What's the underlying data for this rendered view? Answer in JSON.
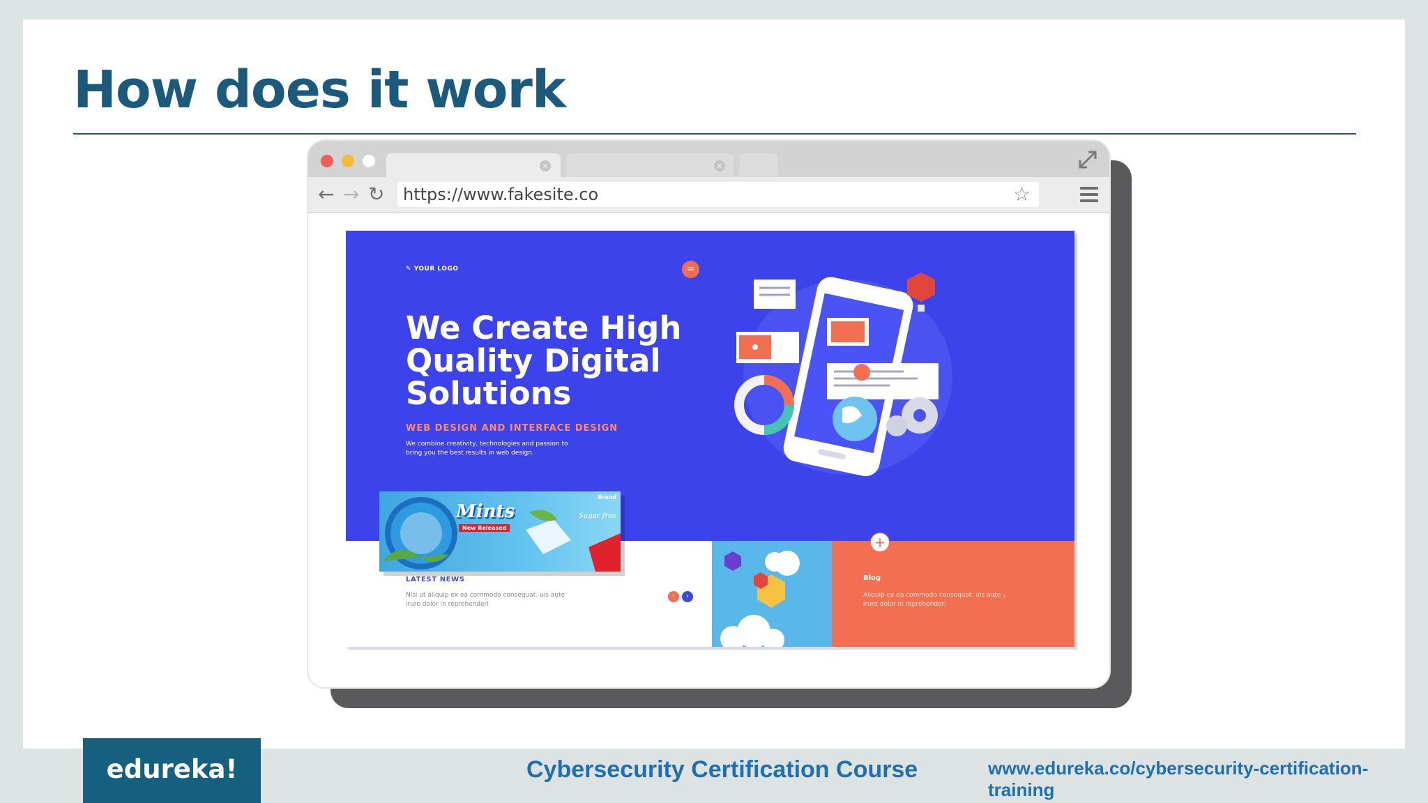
{
  "slide": {
    "title": "How does it work"
  },
  "browser": {
    "url": "https://www.fakesite.co",
    "colors": {
      "close": "#ee5f55",
      "minimize": "#f5bd34",
      "maximize": "#ffffff"
    }
  },
  "site": {
    "logo": "YOUR LOGO",
    "hero_title": "We Create High Quality Digital Solutions",
    "hero_subtitle": "WEB DESIGN AND INTERFACE DESIGN",
    "hero_description": "We combine creativity, technologies and passion to bring you the best results in web design.",
    "news_title": "LATEST NEWS",
    "news_text": "Nisi ut aliquip ex ea commodo consequat. uis aute irure dolor in reprehenderi",
    "blog_title": "Blog",
    "blog_text": "Aliquip ex ea commodo consequat. uis aute irure dolor in reprehenderi",
    "colors": {
      "hero": "#3d43ea",
      "accent": "#f36f52"
    }
  },
  "ad": {
    "brand": "Brand",
    "product": "Mints",
    "badge": "New Released",
    "tagline": "Sugar free"
  },
  "footer": {
    "logo": "edureka!",
    "course": "Cybersecurity Certification Course",
    "url": "www.edureka.co/cybersecurity-certification-training"
  }
}
